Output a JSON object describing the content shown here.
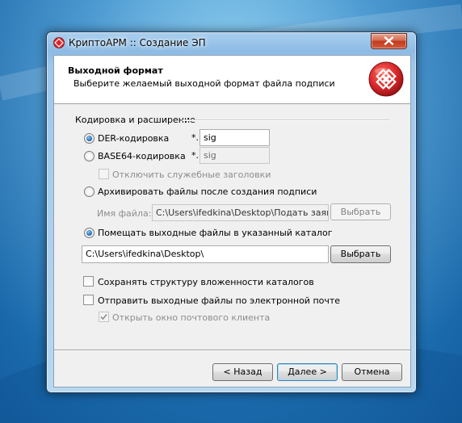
{
  "window": {
    "title": "КриптоАРМ :: Создание ЭП"
  },
  "header": {
    "title": "Выходной формат",
    "subtitle": "Выберите желаемый выходной формат файла подписи"
  },
  "group": {
    "label": "Кодировка и расширение"
  },
  "options": {
    "der_label": "DER-кодировка",
    "der_ext_prefix": "*.",
    "der_ext_value": "sig",
    "base64_label": "BASE64-кодировка",
    "base64_ext_prefix": "*.",
    "base64_ext_value": "sig",
    "disable_headers_label": "Отключить служебные заголовки",
    "archive_label": "Архивировать файлы после создания подписи",
    "filename_label": "Имя файла:",
    "filename_value": "C:\\Users\\ifedkina\\Desktop\\Подать заявление",
    "browse_archive_label": "Выбрать",
    "place_in_dir_label": "Помещать выходные файлы в указанный каталог",
    "dir_value": "C:\\Users\\ifedkina\\Desktop\\",
    "browse_dir_label": "Выбрать",
    "keep_structure_label": "Сохранять структуру вложенности каталогов",
    "send_email_label": "Отправить выходные файлы по электронной почте",
    "open_mail_client_label": "Открыть окно почтового клиента"
  },
  "state": {
    "selected_encoding": "DER",
    "place_in_dir_selected": true,
    "keep_structure_checked": false,
    "send_email_checked": false,
    "open_mail_client_checked": true
  },
  "footer": {
    "back_label": "< Назад",
    "next_label": "Далее >",
    "cancel_label": "Отмена"
  },
  "colors": {
    "logo_red": "#d8262b",
    "radio_accent": "#1b5fae"
  }
}
